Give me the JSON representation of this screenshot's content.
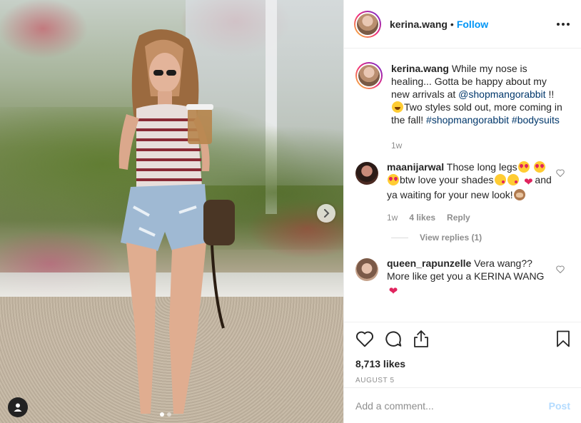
{
  "header": {
    "username": "kerina.wang",
    "separator": "•",
    "follow_label": "Follow"
  },
  "caption": {
    "username": "kerina.wang",
    "text_1": "While my nose is healing... Gotta be happy about my new arrivals at ",
    "mention": "@shopmangorabbit",
    "text_2": " !! ",
    "emoji_1": "face-with-tears-of-joy",
    "text_3": "Two styles sold out, more coming in the fall! ",
    "hashtag_1": "#shopmangorabbit",
    "hashtag_2": "#bodysuits",
    "time": "1w"
  },
  "comments": [
    {
      "username": "maanijarwal",
      "text_1": "Those long legs",
      "text_2": "btw love your shades",
      "text_3": "and ya waiting for your new look!",
      "time": "1w",
      "likes": "4 likes",
      "reply_label": "Reply",
      "view_replies": "View replies (1)",
      "emojis": [
        "smiling-face-with-heart-eyes",
        "face-blowing-a-kiss",
        "red-heart",
        "see-no-evil-monkey"
      ]
    },
    {
      "username": "queen_rapunzelle",
      "text_1": "Vera wang?? More like get you a KERINA WANG",
      "emojis": [
        "red-heart"
      ]
    }
  ],
  "actions": {
    "likes": "8,713 likes",
    "date": "AUGUST 5"
  },
  "add_comment": {
    "placeholder": "Add a comment...",
    "post_label": "Post"
  },
  "icons": {
    "like": "heart-icon",
    "comment": "comment-icon",
    "share": "share-icon",
    "save": "bookmark-icon",
    "more": "more-options-icon",
    "next": "chevron-right-icon",
    "tag": "user-tag-icon"
  },
  "colors": {
    "follow": "#0095f6",
    "link": "#00376b",
    "muted": "#8e8e8e",
    "post_disabled": "#b3dbff"
  }
}
